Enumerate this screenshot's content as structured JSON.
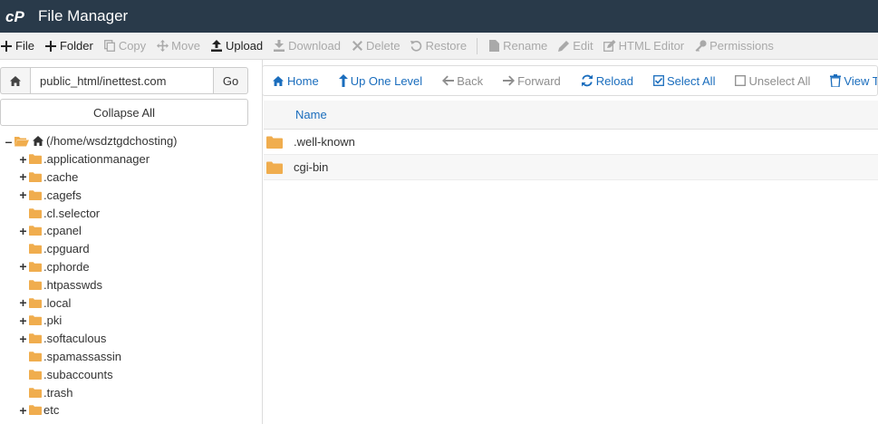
{
  "app": {
    "title": "File Manager",
    "logo": "cpanel-logo"
  },
  "toolbar": [
    {
      "label": "File",
      "icon": "plus-icon",
      "enabled": true
    },
    {
      "label": "Folder",
      "icon": "plus-icon",
      "enabled": true
    },
    {
      "label": "Copy",
      "icon": "copy-icon",
      "enabled": false
    },
    {
      "label": "Move",
      "icon": "move-icon",
      "enabled": false
    },
    {
      "label": "Upload",
      "icon": "upload-icon",
      "enabled": true
    },
    {
      "label": "Download",
      "icon": "download-icon",
      "enabled": false
    },
    {
      "label": "Delete",
      "icon": "delete-icon",
      "enabled": false
    },
    {
      "label": "Restore",
      "icon": "restore-icon",
      "enabled": false
    },
    {
      "label": "Rename",
      "icon": "rename-icon",
      "enabled": false
    },
    {
      "label": "Edit",
      "icon": "pencil-icon",
      "enabled": false
    },
    {
      "label": "HTML Editor",
      "icon": "html-editor-icon",
      "enabled": false
    },
    {
      "label": "Permissions",
      "icon": "key-icon",
      "enabled": false
    }
  ],
  "left": {
    "path_value": "public_html/inettest.com",
    "go_label": "Go",
    "collapse_label": "Collapse All",
    "root_label": "(/home/wsdztgdchosting)",
    "tree": [
      {
        "name": ".applicationmanager",
        "expandable": true
      },
      {
        "name": ".cache",
        "expandable": true
      },
      {
        "name": ".cagefs",
        "expandable": true
      },
      {
        "name": ".cl.selector",
        "expandable": false
      },
      {
        "name": ".cpanel",
        "expandable": true
      },
      {
        "name": ".cpguard",
        "expandable": false
      },
      {
        "name": ".cphorde",
        "expandable": true
      },
      {
        "name": ".htpasswds",
        "expandable": false
      },
      {
        "name": ".local",
        "expandable": true
      },
      {
        "name": ".pki",
        "expandable": true
      },
      {
        "name": ".softaculous",
        "expandable": true
      },
      {
        "name": ".spamassassin",
        "expandable": false
      },
      {
        "name": ".subaccounts",
        "expandable": false
      },
      {
        "name": ".trash",
        "expandable": false
      },
      {
        "name": "etc",
        "expandable": true
      }
    ]
  },
  "nav": [
    {
      "label": "Home",
      "icon": "home-icon",
      "enabled": true
    },
    {
      "label": "Up One Level",
      "icon": "up-arrow-icon",
      "enabled": true
    },
    {
      "label": "Back",
      "icon": "back-arrow-icon",
      "enabled": false
    },
    {
      "label": "Forward",
      "icon": "forward-arrow-icon",
      "enabled": false
    },
    {
      "label": "Reload",
      "icon": "reload-icon",
      "enabled": true
    },
    {
      "label": "Select All",
      "icon": "checked-box-icon",
      "enabled": true
    },
    {
      "label": "Unselect All",
      "icon": "empty-box-icon",
      "enabled": false
    },
    {
      "label": "View T",
      "icon": "trash-icon",
      "enabled": true
    }
  ],
  "files": {
    "column_name": "Name",
    "rows": [
      {
        "name": ".well-known"
      },
      {
        "name": "cgi-bin"
      }
    ]
  },
  "colors": {
    "header": "#293a4a",
    "link": "#1a6dbd",
    "folder": "#f0ad4e",
    "disabled": "#a9a9a9"
  }
}
